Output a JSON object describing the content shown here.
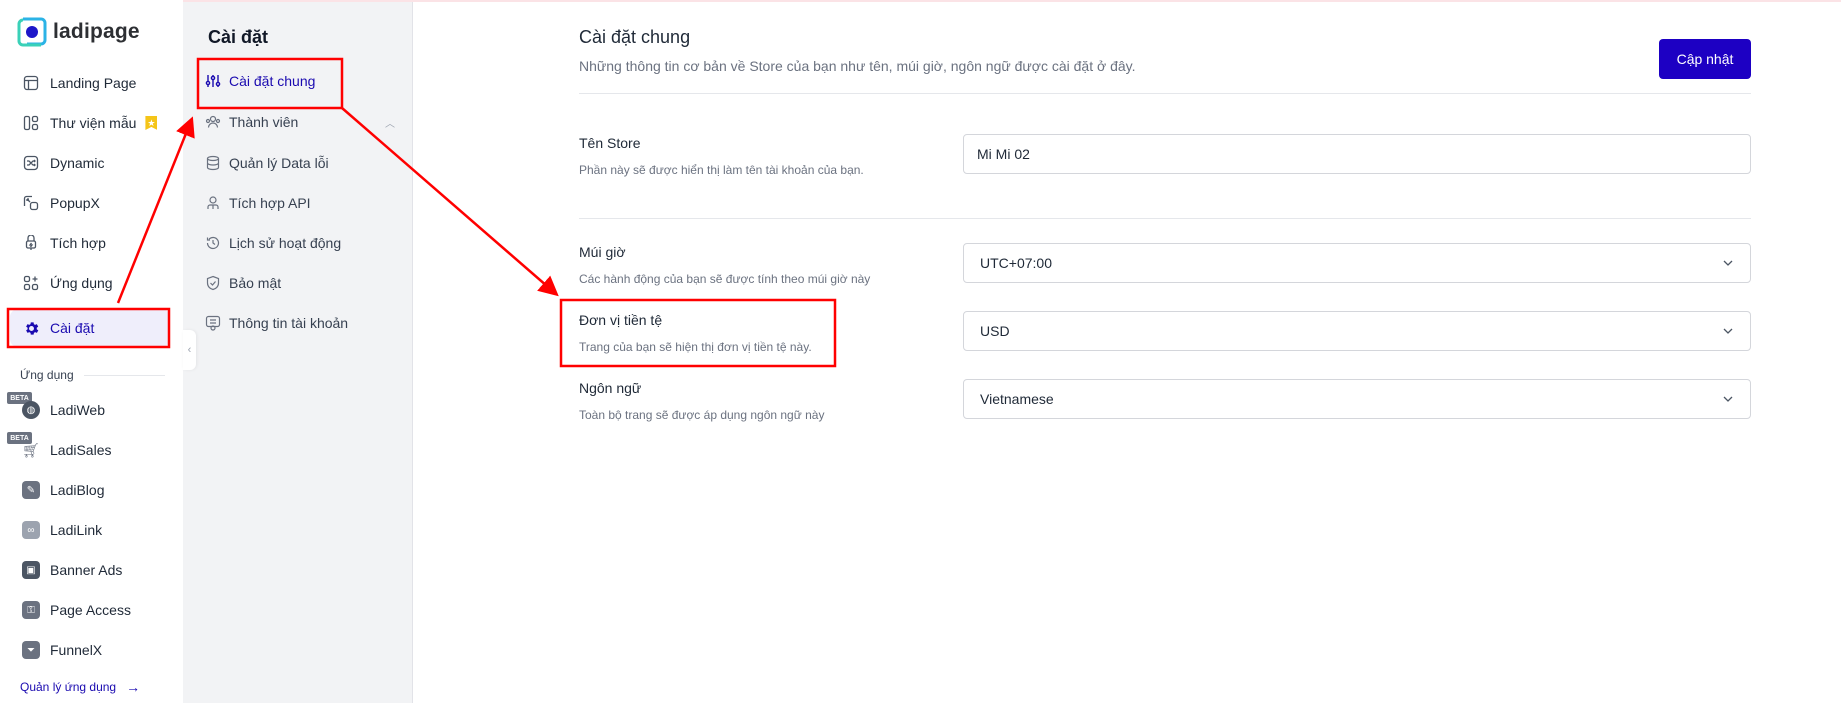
{
  "brand": {
    "name": "ladipage"
  },
  "sidebar": {
    "items": [
      {
        "label": "Landing Page",
        "icon": "layout-icon"
      },
      {
        "label": "Thư viện mẫu",
        "icon": "template-library-icon",
        "badge": "star-bookmark"
      },
      {
        "label": "Dynamic",
        "icon": "shuffle-icon"
      },
      {
        "label": "PopupX",
        "icon": "popup-icon"
      },
      {
        "label": "Tích hợp",
        "icon": "plug-icon"
      },
      {
        "label": "Ứng dụng",
        "icon": "apps-icon"
      },
      {
        "label": "Cài đặt",
        "icon": "gear-icon",
        "active": true
      }
    ],
    "apps_section_label": "Ứng dụng",
    "apps": [
      {
        "label": "LadiWeb",
        "icon": "globe-icon",
        "badge": "BETA"
      },
      {
        "label": "LadiSales",
        "icon": "cart-icon",
        "badge": "BETA"
      },
      {
        "label": "LadiBlog",
        "icon": "blog-edit-icon"
      },
      {
        "label": "LadiLink",
        "icon": "link-icon"
      },
      {
        "label": "Banner Ads",
        "icon": "banner-image-icon"
      },
      {
        "label": "Page Access",
        "icon": "key-icon"
      },
      {
        "label": "FunnelX",
        "icon": "funnel-icon"
      }
    ],
    "manage_apps_label": "Quản lý ứng dụng"
  },
  "settings_nav": {
    "title": "Cài đặt",
    "items": [
      {
        "label": "Cài đặt chung",
        "icon": "sliders-icon",
        "active": true
      },
      {
        "label": "Thành viên",
        "icon": "users-icon",
        "expandable": true
      },
      {
        "label": "Quản lý Data lỗi",
        "icon": "database-icon"
      },
      {
        "label": "Tích hợp API",
        "icon": "api-icon"
      },
      {
        "label": "Lịch sử hoạt động",
        "icon": "history-icon"
      },
      {
        "label": "Bảo mật",
        "icon": "shield-icon"
      },
      {
        "label": "Thông tin tài khoản",
        "icon": "account-info-icon"
      }
    ]
  },
  "main": {
    "title": "Cài đặt chung",
    "description": "Những thông tin cơ bản về Store của bạn như tên, múi giờ, ngôn ngữ được cài đặt ở đây.",
    "update_button": "Cập nhật",
    "fields": {
      "store_name": {
        "label": "Tên Store",
        "description": "Phần này sẽ được hiển thị làm tên tài khoản của bạn.",
        "value": "Mi Mi 02"
      },
      "timezone": {
        "label": "Múi giờ",
        "description": "Các hành động của bạn sẽ được tính theo múi giờ này",
        "value": "UTC+07:00"
      },
      "currency": {
        "label": "Đơn vị tiền tệ",
        "description": "Trang của bạn sẽ hiện thị đơn vị tiền tệ này.",
        "value": "USD"
      },
      "language": {
        "label": "Ngôn ngữ",
        "description": "Toàn bộ trang sẽ được áp dụng ngôn ngữ này",
        "value": "Vietnamese"
      }
    }
  },
  "colors": {
    "accent": "#1d00c3",
    "active_text": "#1a0ab0",
    "annotation": "#ff0000"
  }
}
